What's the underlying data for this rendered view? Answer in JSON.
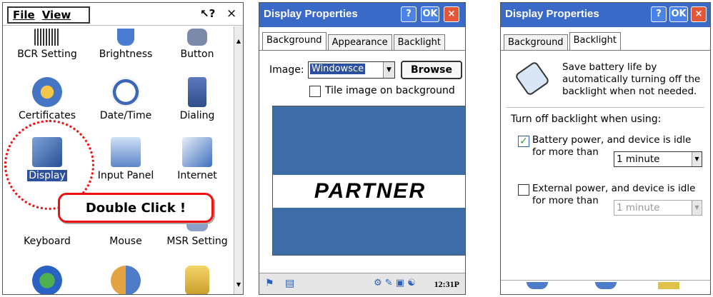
{
  "control_panel": {
    "menu_file": "File",
    "menu_view": "View",
    "help": "?",
    "close": "×",
    "items": [
      {
        "label": "BCR Setting",
        "icon": "barcode-icon"
      },
      {
        "label": "Brightness",
        "icon": "brightness-icon"
      },
      {
        "label": "Button",
        "icon": "button-icon"
      },
      {
        "label": "Certificates",
        "icon": "certificates-icon"
      },
      {
        "label": "Date/Time",
        "icon": "clock-icon"
      },
      {
        "label": "Dialing",
        "icon": "phone-icon"
      },
      {
        "label": "Display",
        "icon": "display-icon"
      },
      {
        "label": "Input Panel",
        "icon": "keyboard-icon"
      },
      {
        "label": "Internet",
        "icon": "internet-icon"
      },
      {
        "label": "Keyboard",
        "icon": "keyboard-settings-icon"
      },
      {
        "label": "Mouse",
        "icon": "mouse-icon"
      },
      {
        "label": "MSR Setting",
        "icon": "card-reader-icon"
      }
    ],
    "callout": "Double Click !"
  },
  "display_bg": {
    "title": "Display Properties",
    "help_btn": "?",
    "ok_btn": "OK",
    "close_btn": "×",
    "tabs": [
      "Background",
      "Appearance",
      "Backlight"
    ],
    "image_label": "Image:",
    "image_value": "Windowsce",
    "browse": "Browse",
    "tile_label": "Tile image on background",
    "logo_text": "PARTNER",
    "clock": "12:31P"
  },
  "display_bl": {
    "title": "Display Properties",
    "help_btn": "?",
    "ok_btn": "OK",
    "close_btn": "×",
    "tabs": [
      "Background",
      "Backlight"
    ],
    "desc": "Save battery life by automatically turning off the backlight when not needed.",
    "heading": "Turn off backlight when using:",
    "battery_text": "Battery power, and device is idle for more than",
    "battery_checked": true,
    "battery_value": "1 minute",
    "external_text": "External power, and device is idle for more than",
    "external_checked": false,
    "external_value": "1 minute"
  },
  "colors": {
    "title_bar": "#3a69c8",
    "callout_border": "#e11111",
    "selection": "#2c4f9e",
    "preview_bg": "#3e6ca6"
  }
}
